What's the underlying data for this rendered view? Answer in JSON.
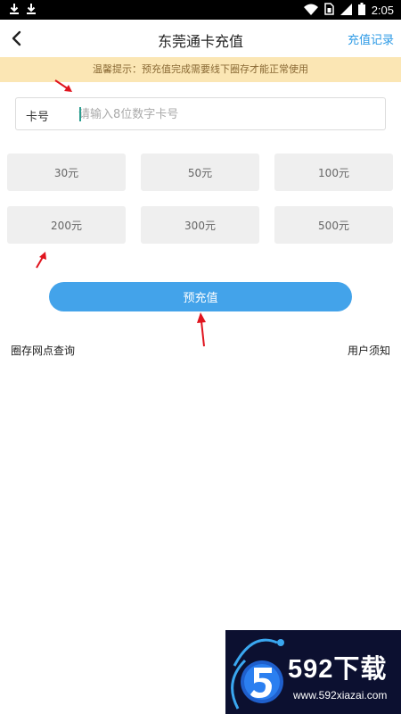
{
  "status_bar": {
    "time": "2:05",
    "icons": [
      "download-icon",
      "download-icon",
      "wifi-icon",
      "sim-icon",
      "signal-icon",
      "battery-icon"
    ]
  },
  "header": {
    "title": "东莞通卡充值",
    "history_link": "充值记录",
    "back_icon": "chevron-left-icon"
  },
  "notice": "温馨提示：预充值完成需要线下圈存才能正常使用",
  "card": {
    "label": "卡号",
    "placeholder": "请输入8位数字卡号",
    "value": ""
  },
  "amounts": [
    "30元",
    "50元",
    "100元",
    "200元",
    "300元",
    "500元"
  ],
  "submit_label": "预充值",
  "footer_links": {
    "left": "圈存网点查询",
    "right": "用户须知"
  },
  "colors": {
    "accent": "#43a3ea",
    "link": "#2e9be6",
    "notice_bg": "#fbe6b4",
    "annotation_arrow": "#e0141e"
  },
  "watermark": {
    "brand": "592下载",
    "url": "www.592xiazai.com"
  }
}
